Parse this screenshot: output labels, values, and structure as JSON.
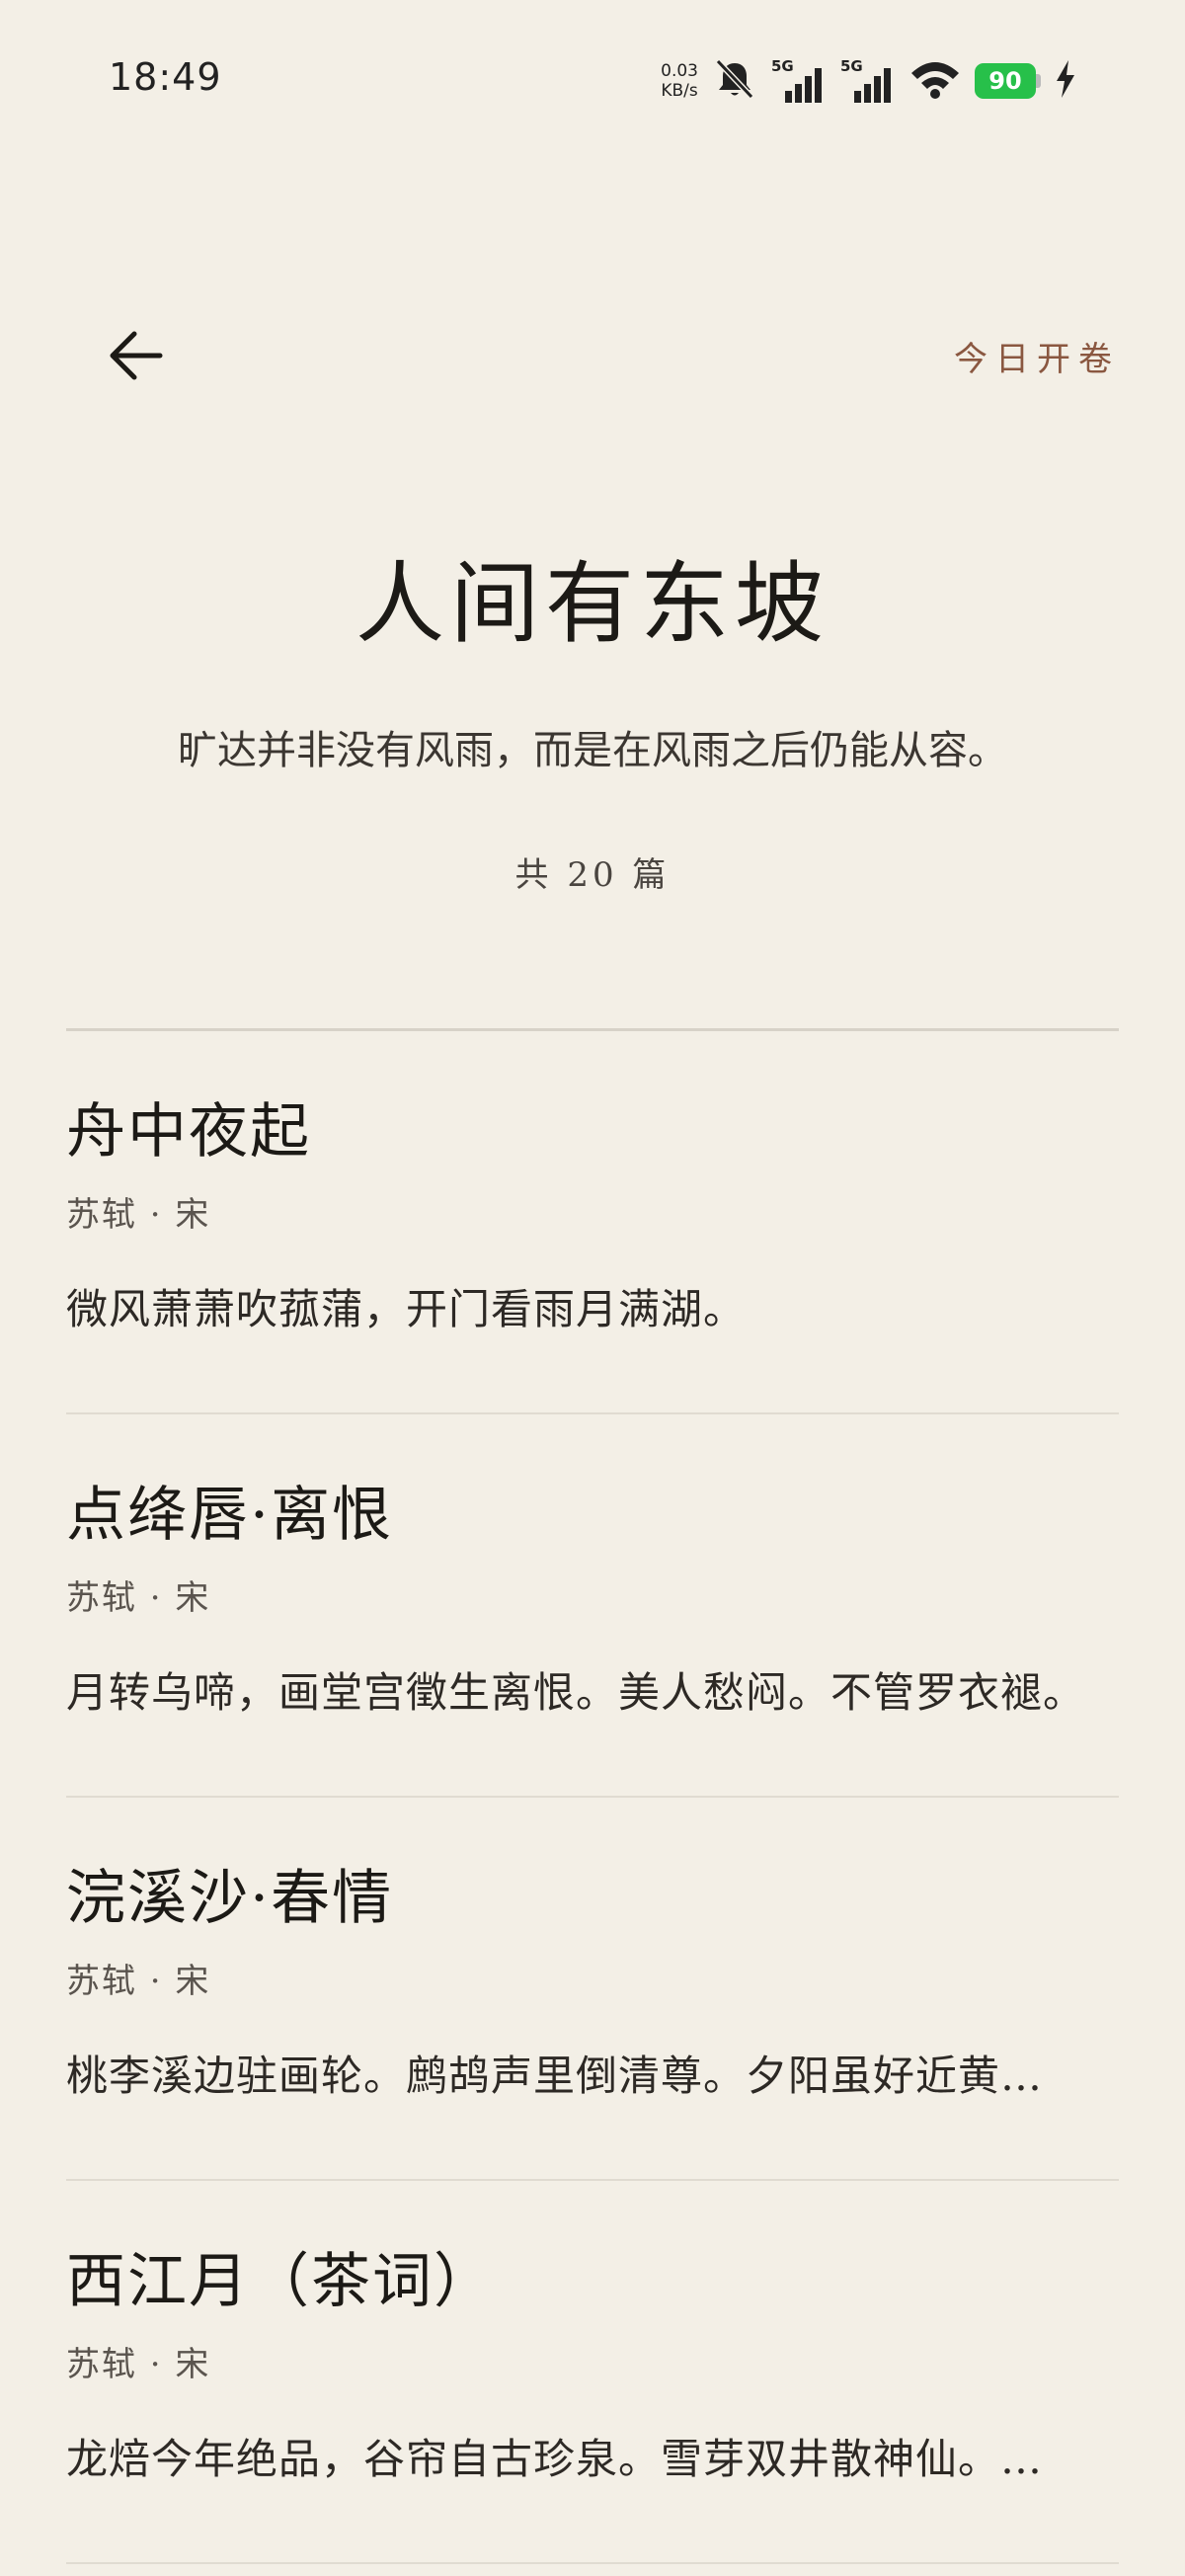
{
  "status_bar": {
    "time": "18:49",
    "net_speed_value": "0.03",
    "net_speed_unit": "KB/s",
    "signal1_label": "5G",
    "signal2_label": "5G",
    "battery_level": "90",
    "icons": [
      "bell-muted-icon",
      "signal-icon",
      "signal-icon",
      "wifi-icon",
      "battery-icon",
      "charging-icon"
    ]
  },
  "nav": {
    "back_icon": "arrow-left-icon",
    "today_label": "今日开卷"
  },
  "collection": {
    "title": "人间有东坡",
    "subtitle": "旷达并非没有风雨，而是在风雨之后仍能从容。",
    "count_label": "共 20 篇"
  },
  "poems": [
    {
      "title": "舟中夜起",
      "author": "苏轼 · 宋",
      "excerpt": "微风萧萧吹菰蒲，开门看雨月满湖。"
    },
    {
      "title": "点绛唇·离恨",
      "author": "苏轼 · 宋",
      "excerpt": "月转乌啼，画堂宫徵生离恨。美人愁闷。不管罗衣褪。"
    },
    {
      "title": "浣溪沙·春情",
      "author": "苏轼 · 宋",
      "excerpt": "桃李溪边驻画轮。鹧鸪声里倒清尊。夕阳虽好近黄…"
    },
    {
      "title": "西江月（茶词）",
      "author": "苏轼 · 宋",
      "excerpt": "龙焙今年绝品，谷帘自古珍泉。雪芽双井散神仙。…"
    }
  ]
}
